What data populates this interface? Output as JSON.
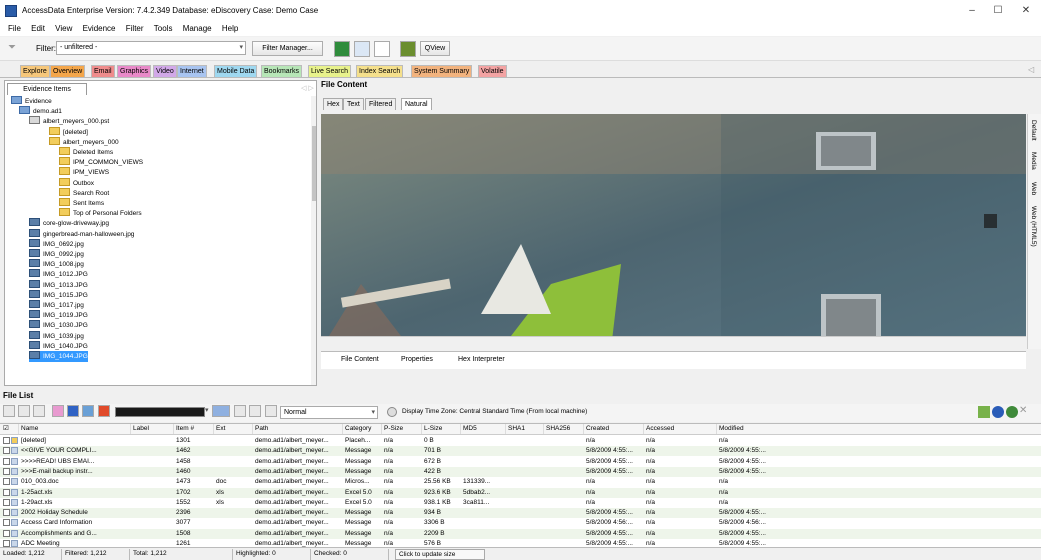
{
  "window": {
    "title": "AccessData Enterprise Version: 7.4.2.349 Database: eDiscovery Case: Demo Case",
    "minimize": "–",
    "maximize": "☐",
    "close": "✕"
  },
  "menu": [
    "File",
    "Edit",
    "View",
    "Evidence",
    "Filter",
    "Tools",
    "Manage",
    "Help"
  ],
  "filterbar": {
    "filter_label": "Filter:",
    "filter_value": "- unfiltered -",
    "filter_manager": "Filter Manager...",
    "qview": "QView"
  },
  "tabs": [
    {
      "label": "Explore",
      "color": "#f6c77a"
    },
    {
      "label": "Overview",
      "color": "#f4a64a"
    },
    {
      "label": "Email",
      "color": "#ef8c8c"
    },
    {
      "label": "Graphics",
      "color": "#e889c8"
    },
    {
      "label": "Video",
      "color": "#d1a8e8"
    },
    {
      "label": "Internet",
      "color": "#a8c4f0"
    },
    {
      "label": "Mobile Data",
      "color": "#9fd8f0"
    },
    {
      "label": "Bookmarks",
      "color": "#b7e6b7"
    },
    {
      "label": "Live Search",
      "color": "#e8f28c"
    },
    {
      "label": "Index Search",
      "color": "#f5e08c"
    },
    {
      "label": "System Summary",
      "color": "#f2b37e"
    },
    {
      "label": "Volatile",
      "color": "#f3a3a3"
    }
  ],
  "evidence_panel": {
    "tab": "Evidence Items",
    "tree": [
      {
        "label": "Evidence",
        "icon": "evid"
      },
      {
        "label": "demo.ad1",
        "icon": "evid"
      },
      {
        "label": "albert_meyers_000.pst",
        "icon": "pst"
      },
      {
        "label": "[deleted]",
        "icon": "folder"
      },
      {
        "label": "albert_meyers_000",
        "icon": "folder"
      },
      {
        "label": "Deleted Items",
        "icon": "folder"
      },
      {
        "label": "IPM_COMMON_VIEWS",
        "icon": "folder"
      },
      {
        "label": "IPM_VIEWS",
        "icon": "folder"
      },
      {
        "label": "Outbox",
        "icon": "folder"
      },
      {
        "label": "Search Root",
        "icon": "folder"
      },
      {
        "label": "Sent Items",
        "icon": "folder"
      },
      {
        "label": "Top of Personal Folders",
        "icon": "folder"
      },
      {
        "label": "core-glow-driveway.jpg",
        "icon": "img"
      },
      {
        "label": "gingerbread-man-halloween.jpg",
        "icon": "img"
      },
      {
        "label": "IMG_0692.jpg",
        "icon": "img"
      },
      {
        "label": "IMG_0992.jpg",
        "icon": "img"
      },
      {
        "label": "IMG_1008.jpg",
        "icon": "img"
      },
      {
        "label": "IMG_1012.JPG",
        "icon": "img"
      },
      {
        "label": "IMG_1013.JPG",
        "icon": "img"
      },
      {
        "label": "IMG_1015.JPG",
        "icon": "img"
      },
      {
        "label": "IMG_1017.jpg",
        "icon": "img"
      },
      {
        "label": "IMG_1019.JPG",
        "icon": "img"
      },
      {
        "label": "IMG_1030.JPG",
        "icon": "img"
      },
      {
        "label": "IMG_1039.jpg",
        "icon": "img"
      },
      {
        "label": "IMG_1040.JPG",
        "icon": "img"
      },
      {
        "label": "IMG_1044.JPG",
        "icon": "img",
        "selected": true
      }
    ]
  },
  "content_panel": {
    "title": "File Content",
    "view_tabs": [
      "Hex",
      "Text",
      "Filtered",
      "Natural"
    ],
    "bottom_tabs": [
      "File Content",
      "Properties",
      "Hex Interpreter"
    ],
    "side_tabs": [
      "Default",
      "Media",
      "Web",
      "Web (HTML5)"
    ]
  },
  "filelist": {
    "title": "File List",
    "view_mode": "Normal",
    "timezone": "Display Time Zone: Central Standard Time  (From local machine)",
    "columns": [
      "Name",
      "Label",
      "Item #",
      "Ext",
      "Path",
      "Category",
      "P-Size",
      "L-Size",
      "MD5",
      "SHA1",
      "SHA256",
      "Created",
      "Accessed",
      "Modified"
    ],
    "rows": [
      [
        "[deleted]",
        "",
        "1301",
        "",
        "demo.ad1/albert_meyer...",
        "Placeh...",
        "n/a",
        "0 B",
        "",
        "",
        "",
        "n/a",
        "n/a",
        "n/a"
      ],
      [
        "<<GIVE YOUR COMPLI...",
        "",
        "1462",
        "",
        "demo.ad1/albert_meyer...",
        "Message",
        "n/a",
        "701 B",
        "",
        "",
        "",
        "5/8/2009 4:55:...",
        "n/a",
        "5/8/2009 4:55:..."
      ],
      [
        ">>>>READ! UBS EMAI...",
        "",
        "1458",
        "",
        "demo.ad1/albert_meyer...",
        "Message",
        "n/a",
        "672 B",
        "",
        "",
        "",
        "5/8/2009 4:55:...",
        "n/a",
        "5/8/2009 4:55:..."
      ],
      [
        ">>>E-mail backup instr...",
        "",
        "1460",
        "",
        "demo.ad1/albert_meyer...",
        "Message",
        "n/a",
        "422 B",
        "",
        "",
        "",
        "5/8/2009 4:55:...",
        "n/a",
        "5/8/2009 4:55:..."
      ],
      [
        "010_003.doc",
        "",
        "1473",
        "doc",
        "demo.ad1/albert_meyer...",
        "Micros...",
        "n/a",
        "25.56 KB",
        "131339...",
        "",
        "",
        "n/a",
        "n/a",
        "n/a"
      ],
      [
        "1-25act.xls",
        "",
        "1702",
        "xls",
        "demo.ad1/albert_meyer...",
        "Excel 5.0",
        "n/a",
        "923.6 KB",
        "5dbab2...",
        "",
        "",
        "n/a",
        "n/a",
        "n/a"
      ],
      [
        "1-29act.xls",
        "",
        "1552",
        "xls",
        "demo.ad1/albert_meyer...",
        "Excel 5.0",
        "n/a",
        "938.1 KB",
        "3ca811...",
        "",
        "",
        "n/a",
        "n/a",
        "n/a"
      ],
      [
        "2002 Holiday Schedule",
        "",
        "2396",
        "",
        "demo.ad1/albert_meyer...",
        "Message",
        "n/a",
        "934 B",
        "",
        "",
        "",
        "5/8/2009 4:55:...",
        "n/a",
        "5/8/2009 4:55:..."
      ],
      [
        "Access Card Information",
        "",
        "3077",
        "",
        "demo.ad1/albert_meyer...",
        "Message",
        "n/a",
        "3306 B",
        "",
        "",
        "",
        "5/8/2009 4:56:...",
        "n/a",
        "5/8/2009 4:56:..."
      ],
      [
        "Accomplishments and G...",
        "",
        "1508",
        "",
        "demo.ad1/albert_meyer...",
        "Message",
        "n/a",
        "2209 B",
        "",
        "",
        "",
        "5/8/2009 4:55:...",
        "n/a",
        "5/8/2009 4:55:..."
      ],
      [
        "ADC Meeting",
        "",
        "1261",
        "",
        "demo.ad1/albert_meyer...",
        "Message",
        "n/a",
        "576 B",
        "",
        "",
        "",
        "5/8/2009 4:55:...",
        "n/a",
        "5/8/2009 4:55:..."
      ]
    ]
  },
  "status": {
    "loaded": "Loaded: 1,212",
    "filtered": "Filtered: 1,212",
    "total": "Total: 1,212",
    "highlighted": "Highlighted: 0",
    "checked": "Checked: 0",
    "update": "Click to update size"
  }
}
